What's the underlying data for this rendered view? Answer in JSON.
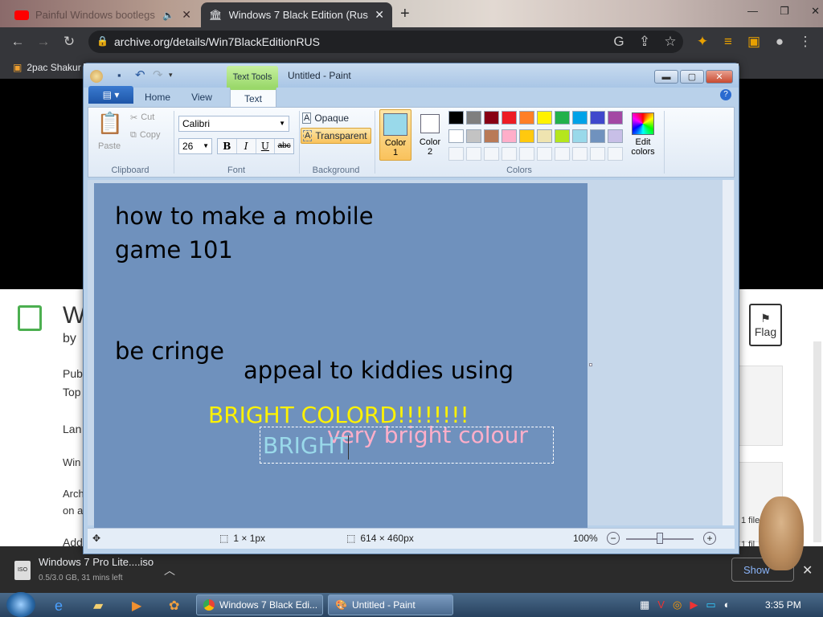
{
  "browser": {
    "tabs": [
      {
        "title": "Painful Windows bootlegs -"
      },
      {
        "title": "Windows 7 Black Edition (Russia"
      }
    ],
    "new_tab": "+",
    "url": "archive.org/details/Win7BlackEditionRUS",
    "bookmark": "2pac Shakur"
  },
  "page": {
    "title_fragment": "W",
    "by": "by",
    "lines": [
      "Pub",
      "Top",
      "Lan",
      "Win",
      "Arch",
      "on a",
      "Add"
    ],
    "flag_label": "Flag",
    "file_labels": [
      "1 file",
      "1 fil"
    ]
  },
  "download": {
    "filename": "Windows 7 Pro Lite....iso",
    "progress": "0.5/3.0 GB, 31 mins left",
    "show_all": "Show"
  },
  "paint": {
    "title": "Untitled - Paint",
    "context_tab": "Text Tools",
    "tabs": [
      "Home",
      "View",
      "Text"
    ],
    "clipboard": {
      "paste": "Paste",
      "cut": "Cut",
      "copy": "Copy",
      "label": "Clipboard"
    },
    "font": {
      "family": "Calibri",
      "size": "26",
      "bold": "B",
      "italic": "I",
      "underline": "U",
      "strike": "abc",
      "label": "Font"
    },
    "background": {
      "opaque": "Opaque",
      "transparent": "Transparent",
      "label": "Background"
    },
    "colors": {
      "color1": "Color\n1",
      "color1_a": "Color",
      "color1_b": "1",
      "color2_a": "Color",
      "color2_b": "2",
      "edit_a": "Edit",
      "edit_b": "colors",
      "label": "Colors",
      "row1": [
        "#000000",
        "#7f7f7f",
        "#880015",
        "#ed1c24",
        "#ff7f27",
        "#fff200",
        "#22b14c",
        "#00a2e8",
        "#3f48cc",
        "#a349a4"
      ],
      "row2": [
        "#ffffff",
        "#c3c3c3",
        "#b97a57",
        "#ffaec9",
        "#ffc90e",
        "#efe4b0",
        "#b5e61d",
        "#99d9ea",
        "#7092be",
        "#c8bfe7"
      ]
    },
    "canvas_text": {
      "line1": "how to make a mobile",
      "line2": "game 101",
      "line3": "be cringe",
      "line4": "appeal to kiddies using",
      "line5": "BRIGHT COLORD!!!!!!!!",
      "line6": "very bright colour",
      "line7": "BRIGHT"
    },
    "status": {
      "selection": "1 × 1px",
      "size": "614 × 460px",
      "zoom": "100%"
    }
  },
  "taskbar": {
    "buttons": [
      "Windows 7 Black Edi...",
      "Untitled - Paint"
    ],
    "time": "3:35 PM"
  }
}
